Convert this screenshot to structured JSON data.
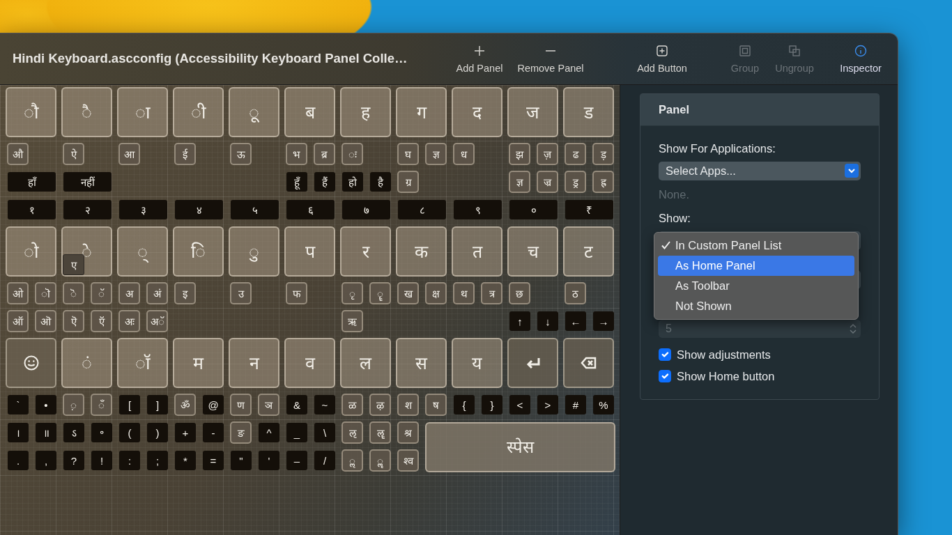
{
  "window": {
    "title": "Hindi Keyboard.ascconfig (Accessibility Keyboard Panel Colle…"
  },
  "toolbar": [
    {
      "kind": "add",
      "label": "Add Panel",
      "disabled": false,
      "on": false
    },
    {
      "kind": "remove",
      "label": "Remove Panel",
      "disabled": false,
      "on": false
    },
    {
      "kind": "add-button",
      "label": "Add Button",
      "disabled": false,
      "on": false
    },
    {
      "kind": "group",
      "label": "Group",
      "disabled": true,
      "on": false
    },
    {
      "kind": "ungroup",
      "label": "Ungroup",
      "disabled": true,
      "on": false
    },
    {
      "kind": "info",
      "label": "Inspector",
      "disabled": false,
      "on": true
    }
  ],
  "keyboard": {
    "rows": [
      {
        "keys": [
          {
            "kind": "big",
            "label": "◌ौ"
          },
          {
            "kind": "big",
            "label": "◌ै"
          },
          {
            "kind": "big",
            "label": "◌ा"
          },
          {
            "kind": "big",
            "label": "◌ी"
          },
          {
            "kind": "big",
            "label": "◌ू"
          },
          {
            "kind": "big",
            "label": "ब"
          },
          {
            "kind": "big",
            "label": "ह"
          },
          {
            "kind": "big",
            "label": "ग"
          },
          {
            "kind": "big",
            "label": "द"
          },
          {
            "kind": "big",
            "label": "ज"
          },
          {
            "kind": "big",
            "label": "ड"
          }
        ]
      },
      {
        "keys": [
          {
            "kind": "small",
            "label": "औ"
          },
          {
            "kind": "small",
            "label": "ऐ"
          },
          {
            "kind": "small",
            "label": "आ"
          },
          {
            "kind": "small",
            "label": "ई"
          },
          {
            "kind": "small",
            "label": "ऊ"
          },
          {
            "kind": "small",
            "label": "भ"
          },
          {
            "kind": "small",
            "label": "ब्र"
          },
          {
            "kind": "small",
            "label": "◌ः"
          },
          {
            "kind": "small",
            "label": "घ"
          },
          {
            "kind": "small",
            "label": "ज्ञ"
          },
          {
            "kind": "small",
            "label": "ध"
          },
          {
            "kind": "small",
            "label": "झ"
          },
          {
            "kind": "small",
            "label": "ज़"
          },
          {
            "kind": "small",
            "label": "ढ"
          },
          {
            "kind": "small",
            "label": "ड़"
          }
        ]
      },
      {
        "keys": [
          {
            "kind": "wide",
            "label": "हाँ"
          },
          {
            "kind": "wide",
            "label": "नहीं"
          },
          {
            "kind": "dark",
            "label": "हूँ"
          },
          {
            "kind": "dark",
            "label": "हैं"
          },
          {
            "kind": "dark",
            "label": "हो"
          },
          {
            "kind": "dark",
            "label": "है"
          },
          {
            "kind": "small",
            "label": "ग्र"
          },
          {
            "kind": "small",
            "label": "ज्ञ"
          },
          {
            "kind": "small",
            "label": "ज्र"
          },
          {
            "kind": "small",
            "label": "ड्र"
          },
          {
            "kind": "small",
            "label": "ह्र"
          }
        ]
      },
      {
        "keys": [
          {
            "kind": "wide",
            "label": "१"
          },
          {
            "kind": "wide",
            "label": "२"
          },
          {
            "kind": "wide",
            "label": "३"
          },
          {
            "kind": "wide",
            "label": "४"
          },
          {
            "kind": "wide",
            "label": "५"
          },
          {
            "kind": "wide",
            "label": "६"
          },
          {
            "kind": "wide",
            "label": "७"
          },
          {
            "kind": "wide",
            "label": "८"
          },
          {
            "kind": "wide",
            "label": "९"
          },
          {
            "kind": "wide",
            "label": "०"
          },
          {
            "kind": "wide",
            "label": "₹"
          }
        ]
      },
      {
        "keys": [
          {
            "kind": "big",
            "label": "◌ो"
          },
          {
            "kind": "big",
            "label": "◌े"
          },
          {
            "kind": "big",
            "label": "◌्"
          },
          {
            "kind": "big",
            "label": "◌ि"
          },
          {
            "kind": "big",
            "label": "◌ु"
          },
          {
            "kind": "big",
            "label": "प"
          },
          {
            "kind": "big",
            "label": "र"
          },
          {
            "kind": "big",
            "label": "क"
          },
          {
            "kind": "big",
            "label": "त"
          },
          {
            "kind": "big",
            "label": "च"
          },
          {
            "kind": "big",
            "label": "ट"
          },
          {
            "kind": "popup",
            "label": "ए"
          }
        ]
      },
      {
        "keys": [
          {
            "kind": "small",
            "label": "ओ"
          },
          {
            "kind": "small",
            "label": "◌ॊ"
          },
          {
            "kind": "small",
            "label": "◌ॆ"
          },
          {
            "kind": "small",
            "label": "◌ॅ"
          },
          {
            "kind": "small",
            "label": "अ"
          },
          {
            "kind": "small",
            "label": "अं"
          },
          {
            "kind": "small",
            "label": "इ"
          },
          {
            "kind": "small",
            "label": "उ"
          },
          {
            "kind": "small",
            "label": "फ"
          },
          {
            "kind": "small",
            "label": "◌ृ"
          },
          {
            "kind": "small",
            "label": "◌ॄ"
          },
          {
            "kind": "small",
            "label": "ख"
          },
          {
            "kind": "small",
            "label": "क्ष"
          },
          {
            "kind": "small",
            "label": "थ"
          },
          {
            "kind": "small",
            "label": "त्र"
          },
          {
            "kind": "small",
            "label": "छ"
          },
          {
            "kind": "small",
            "label": "ठ"
          }
        ]
      },
      {
        "keys": [
          {
            "kind": "small",
            "label": "ऑ"
          },
          {
            "kind": "small",
            "label": "ऒ"
          },
          {
            "kind": "small",
            "label": "ऎ"
          },
          {
            "kind": "small",
            "label": "ऍ"
          },
          {
            "kind": "small",
            "label": "अः"
          },
          {
            "kind": "small",
            "label": "अॅ"
          },
          {
            "kind": "small",
            "label": "ऋ"
          },
          {
            "kind": "dark",
            "label": "↑"
          },
          {
            "kind": "dark",
            "label": "↓"
          },
          {
            "kind": "dark",
            "label": "←"
          },
          {
            "kind": "dark",
            "label": "→"
          }
        ]
      },
      {
        "keys": [
          {
            "kind": "emoji"
          },
          {
            "kind": "big",
            "label": "◌ं"
          },
          {
            "kind": "big",
            "label": "◌ॉ"
          },
          {
            "kind": "big",
            "label": "म"
          },
          {
            "kind": "big",
            "label": "न"
          },
          {
            "kind": "big",
            "label": "व"
          },
          {
            "kind": "big",
            "label": "ल"
          },
          {
            "kind": "big",
            "label": "स"
          },
          {
            "kind": "big",
            "label": "य"
          },
          {
            "kind": "return"
          },
          {
            "kind": "delete"
          }
        ]
      },
      {
        "keys": [
          {
            "kind": "dark",
            "label": "`"
          },
          {
            "kind": "dark",
            "label": "•"
          },
          {
            "kind": "small",
            "label": "◌़"
          },
          {
            "kind": "small",
            "label": "◌ँ"
          },
          {
            "kind": "dark",
            "label": "["
          },
          {
            "kind": "dark",
            "label": "]"
          },
          {
            "kind": "small",
            "label": "ॐ"
          },
          {
            "kind": "dark",
            "label": "@"
          },
          {
            "kind": "small",
            "label": "ण"
          },
          {
            "kind": "small",
            "label": "ञ"
          },
          {
            "kind": "dark",
            "label": "&"
          },
          {
            "kind": "dark",
            "label": "~"
          },
          {
            "kind": "small",
            "label": "ळ"
          },
          {
            "kind": "small",
            "label": "ऴ"
          },
          {
            "kind": "small",
            "label": "श"
          },
          {
            "kind": "small",
            "label": "ष"
          },
          {
            "kind": "dark",
            "label": "{"
          },
          {
            "kind": "dark",
            "label": "}"
          },
          {
            "kind": "dark",
            "label": "<"
          },
          {
            "kind": "dark",
            "label": ">"
          },
          {
            "kind": "dark",
            "label": "#"
          },
          {
            "kind": "dark",
            "label": "%"
          }
        ]
      },
      {
        "keys": [
          {
            "kind": "dark",
            "label": "।"
          },
          {
            "kind": "dark",
            "label": "॥"
          },
          {
            "kind": "dark",
            "label": "ऽ"
          },
          {
            "kind": "dark",
            "label": "॰"
          },
          {
            "kind": "dark",
            "label": "("
          },
          {
            "kind": "dark",
            "label": ")"
          },
          {
            "kind": "dark",
            "label": "+"
          },
          {
            "kind": "dark",
            "label": "-"
          },
          {
            "kind": "small",
            "label": "ङ"
          },
          {
            "kind": "dark",
            "label": "^"
          },
          {
            "kind": "dark",
            "label": "_"
          },
          {
            "kind": "dark",
            "label": "\\"
          },
          {
            "kind": "small",
            "label": "ऌ"
          },
          {
            "kind": "small",
            "label": "ॡ"
          },
          {
            "kind": "small",
            "label": "श्र"
          },
          {
            "kind": "space",
            "label": "स्पेस"
          }
        ]
      },
      {
        "keys": [
          {
            "kind": "dark",
            "label": "."
          },
          {
            "kind": "dark",
            "label": ","
          },
          {
            "kind": "dark",
            "label": "?"
          },
          {
            "kind": "dark",
            "label": "!"
          },
          {
            "kind": "dark",
            "label": ":"
          },
          {
            "kind": "dark",
            "label": ";"
          },
          {
            "kind": "dark",
            "label": "*"
          },
          {
            "kind": "dark",
            "label": "="
          },
          {
            "kind": "dark",
            "label": "\""
          },
          {
            "kind": "dark",
            "label": "'"
          },
          {
            "kind": "dark",
            "label": "–"
          },
          {
            "kind": "dark",
            "label": "/"
          },
          {
            "kind": "small",
            "label": "◌ॢ"
          },
          {
            "kind": "small",
            "label": "◌ॣ"
          },
          {
            "kind": "small",
            "label": "श्व"
          }
        ]
      }
    ]
  },
  "inspector": {
    "panel": {
      "title": "Panel",
      "apps_label": "Show For Applications:",
      "apps_select": "Select Apps...",
      "apps_value": "None.",
      "show_label": "Show:",
      "show_menu": {
        "options": [
          {
            "label": "In Custom Panel List",
            "checked": true,
            "selected": false
          },
          {
            "label": "As Home Panel",
            "checked": false,
            "selected": true
          },
          {
            "label": "As Toolbar",
            "checked": false,
            "selected": false
          },
          {
            "label": "Not Shown",
            "checked": false,
            "selected": false
          }
        ]
      },
      "count_field": {
        "value": "5",
        "disabled": true
      },
      "checkboxes": [
        {
          "label": "Show adjustments",
          "checked": true
        },
        {
          "label": "Show Home button",
          "checked": true
        }
      ]
    }
  }
}
